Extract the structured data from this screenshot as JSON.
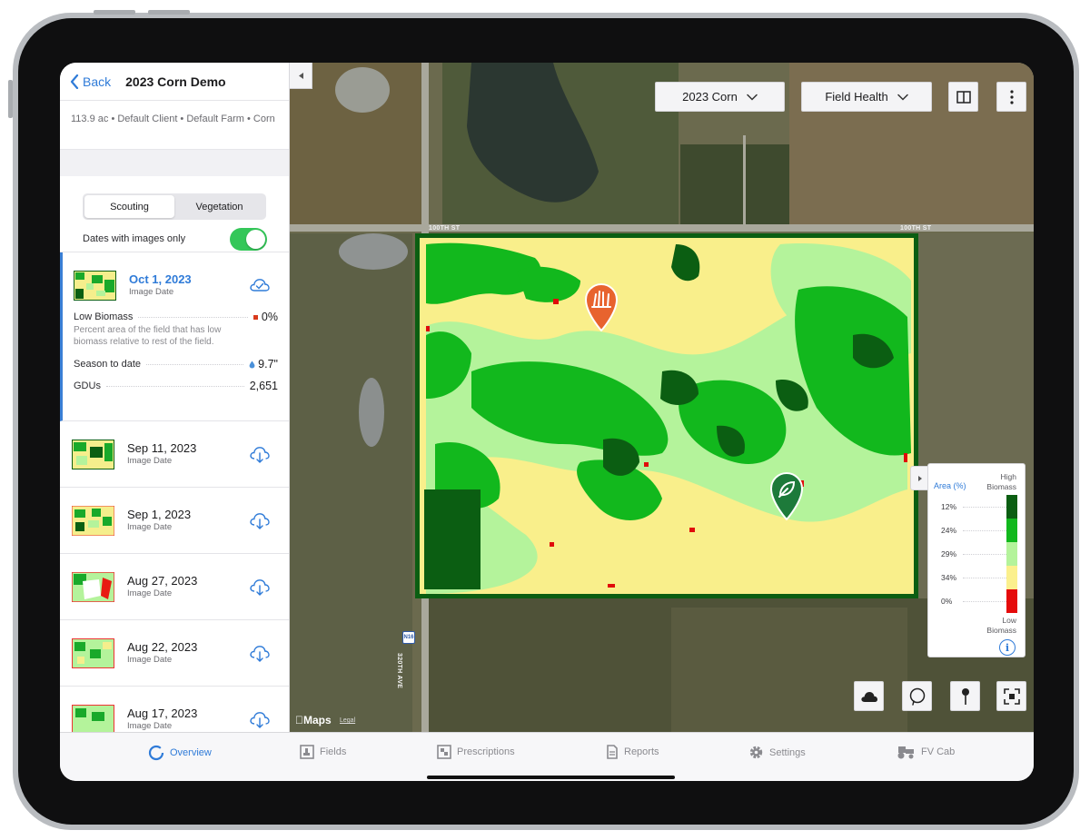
{
  "sidebar": {
    "back_label": "Back",
    "title": "2023 Corn Demo",
    "meta": "113.9 ac • Default Client • Default Farm • Corn",
    "tabs": {
      "scouting": "Scouting",
      "vegetation": "Vegetation"
    },
    "toggle_label": "Dates with images only",
    "toggle_on": true,
    "selected": {
      "date": "Oct 1, 2023",
      "sub": "Image Date",
      "low_biomass_label": "Low Biomass",
      "low_biomass_value": "0%",
      "low_biomass_desc": "Percent area of the field that has low biomass relative to rest of the field.",
      "season_label": "Season to date",
      "season_value": "9.7\"",
      "gdu_label": "GDUs",
      "gdu_value": "2,651"
    },
    "dates": [
      {
        "date": "Sep 11, 2023",
        "sub": "Image Date"
      },
      {
        "date": "Sep 1, 2023",
        "sub": "Image Date"
      },
      {
        "date": "Aug 27, 2023",
        "sub": "Image Date"
      },
      {
        "date": "Aug 22, 2023",
        "sub": "Image Date"
      },
      {
        "date": "Aug 17, 2023",
        "sub": "Image Date"
      }
    ]
  },
  "map": {
    "crop_dropdown": "2023 Corn",
    "layer_dropdown": "Field Health",
    "roads": {
      "top": "100TH ST",
      "top_right": "100TH ST",
      "vertical": "320TH AVE",
      "shield": "N16"
    },
    "brand": "Maps",
    "legal": "Legal",
    "legend": {
      "header": "Area (%)",
      "high_label": "High Biomass",
      "low_label": "Low Biomass",
      "rows": [
        {
          "pct": "12%",
          "color": "#0b5e12"
        },
        {
          "pct": "24%",
          "color": "#12b81d"
        },
        {
          "pct": "29%",
          "color": "#b4f39b"
        },
        {
          "pct": "34%",
          "color": "#fbf08d"
        },
        {
          "pct": "0%",
          "color": "#e50b0b"
        }
      ]
    }
  },
  "tabbar": {
    "overview": "Overview",
    "fields": "Fields",
    "prescriptions": "Prescriptions",
    "reports": "Reports",
    "settings": "Settings",
    "fvcab": "FV Cab"
  },
  "colors": {
    "accent": "#2f7bd8",
    "toggle": "#34c759",
    "marker_orange": "#e8632e",
    "marker_green": "#1d7a3a"
  }
}
